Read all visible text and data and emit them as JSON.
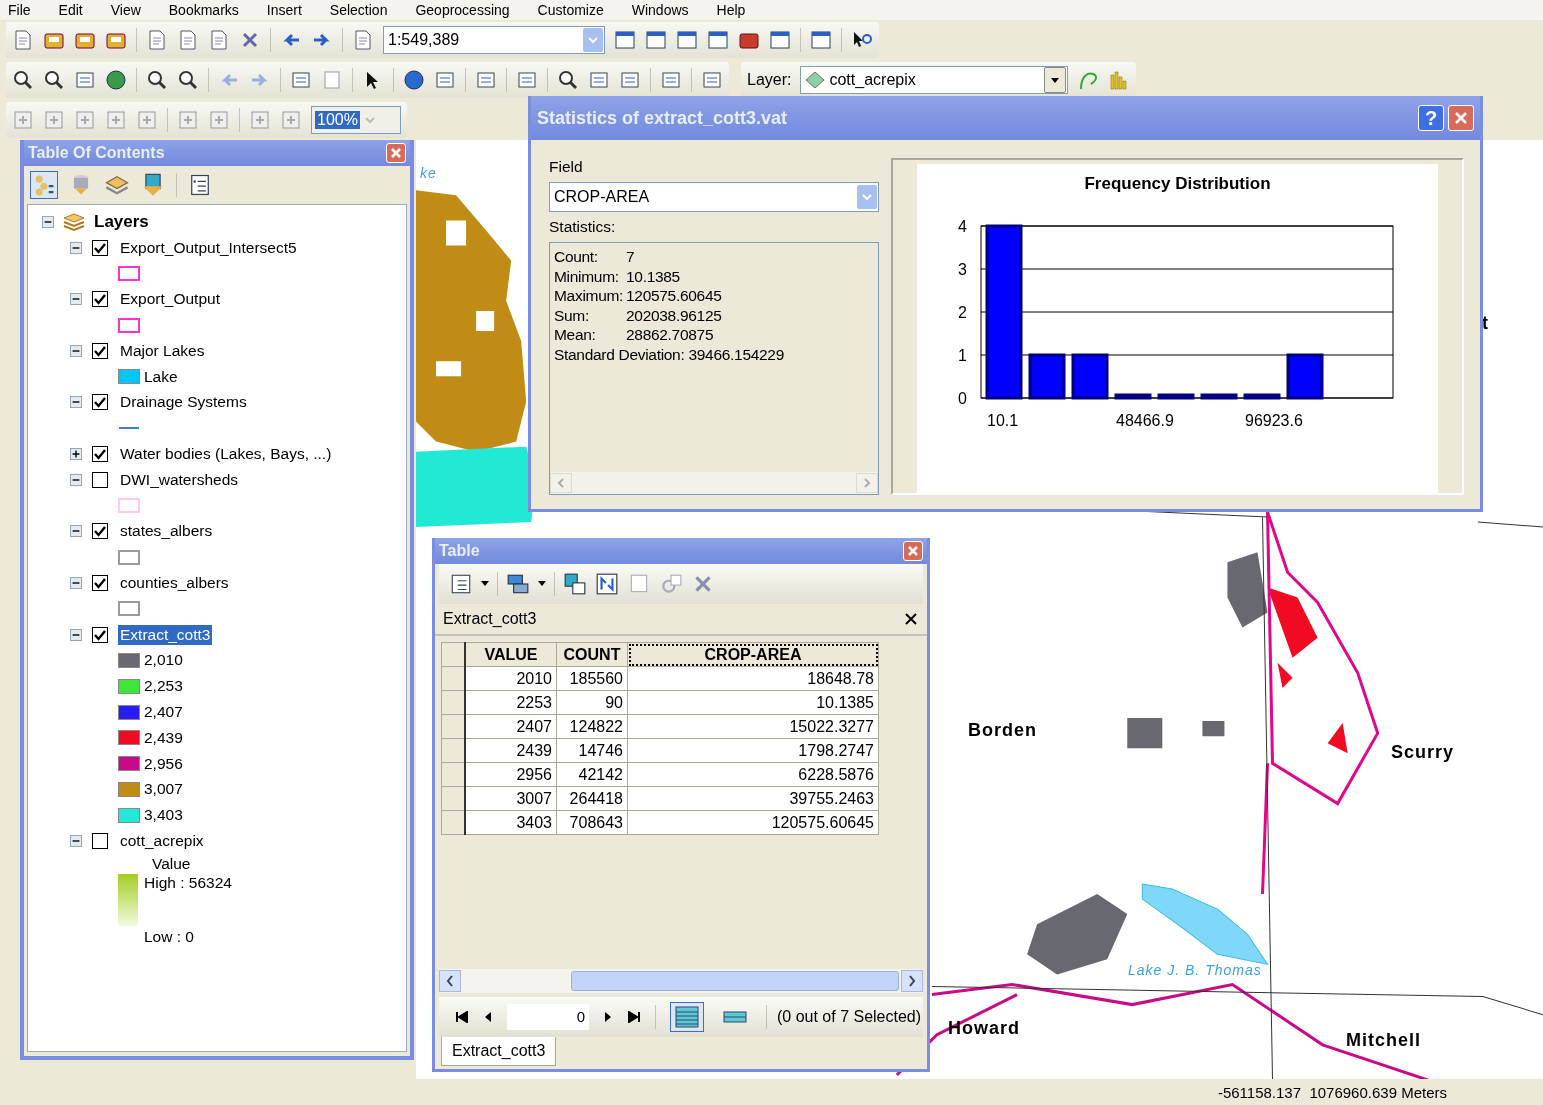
{
  "menu": [
    "File",
    "Edit",
    "View",
    "Bookmarks",
    "Insert",
    "Selection",
    "Geoprocessing",
    "Customize",
    "Windows",
    "Help"
  ],
  "toolbar": {
    "scale": "1:549,389",
    "layer_label": "Layer:",
    "layer": "cott_acrepix",
    "zoom": "100%"
  },
  "toc": {
    "title": "Table Of Contents",
    "root": {
      "label": "Layers",
      "expanded": true,
      "children": [
        {
          "label": "Export_Output_Intersect5",
          "checked": true,
          "expanded": true,
          "selected": false,
          "legend": [
            {
              "kind": "outline",
              "color": "#ff33cc"
            }
          ]
        },
        {
          "label": "Export_Output",
          "checked": true,
          "expanded": true,
          "selected": false,
          "legend": [
            {
              "kind": "outline",
              "color": "#ff33cc"
            }
          ]
        },
        {
          "label": "Major Lakes",
          "checked": true,
          "expanded": true,
          "selected": false,
          "legend": [
            {
              "kind": "swatch",
              "color": "#00c5ff",
              "label": "Lake"
            }
          ]
        },
        {
          "label": "Drainage Systems",
          "checked": true,
          "expanded": true,
          "selected": false,
          "legend": [
            {
              "kind": "line",
              "color": "#3a7ee8"
            }
          ]
        },
        {
          "label": "Water bodies (Lakes, Bays, ...)",
          "checked": true,
          "expanded": false,
          "selected": false
        },
        {
          "label": "DWI_watersheds",
          "checked": false,
          "expanded": true,
          "selected": false,
          "legend": [
            {
              "kind": "outline",
              "color": "#ffc8ec"
            }
          ]
        },
        {
          "label": "states_albers",
          "checked": true,
          "expanded": true,
          "selected": false,
          "legend": [
            {
              "kind": "outline",
              "color": "#9a9a9a"
            }
          ]
        },
        {
          "label": "counties_albers",
          "checked": true,
          "expanded": true,
          "selected": false,
          "legend": [
            {
              "kind": "outline",
              "color": "#9a9a9a"
            }
          ]
        },
        {
          "label": "Extract_cott3",
          "checked": true,
          "expanded": true,
          "selected": true,
          "legend": [
            {
              "kind": "swatch",
              "color": "#686870",
              "label": "2,010"
            },
            {
              "kind": "swatch",
              "color": "#3ee63a",
              "label": "2,253"
            },
            {
              "kind": "swatch",
              "color": "#2a1cf5",
              "label": "2,407"
            },
            {
              "kind": "swatch",
              "color": "#f00a22",
              "label": "2,439"
            },
            {
              "kind": "swatch",
              "color": "#c80a88",
              "label": "2,956"
            },
            {
              "kind": "swatch",
              "color": "#c08c16",
              "label": "3,007"
            },
            {
              "kind": "swatch",
              "color": "#22e8d6",
              "label": "3,403"
            }
          ]
        },
        {
          "label": "cott_acrepix",
          "checked": false,
          "expanded": true,
          "selected": false,
          "legend": [
            {
              "kind": "ramp",
              "title": "Value",
              "high": "High : 56324",
              "low": "Low : 0"
            }
          ]
        }
      ]
    }
  },
  "map_labels": [
    {
      "text": "ke",
      "kind": "water"
    },
    {
      "text": "t",
      "kind": "county"
    },
    {
      "text": "Borden",
      "kind": "county"
    },
    {
      "text": "Scurry",
      "kind": "county"
    },
    {
      "text": "Lake J. B. Thomas",
      "kind": "water"
    },
    {
      "text": "Howard",
      "kind": "county"
    },
    {
      "text": "Mitchell",
      "kind": "county"
    }
  ],
  "statistics": {
    "title": "Statistics of extract_cott3.vat",
    "help_button": "?",
    "field_label": "Field",
    "field": "CROP-AREA",
    "stats_label": "Statistics:",
    "stats": [
      {
        "label": "Count:",
        "value": "7",
        "kind": "aligned"
      },
      {
        "label": "Minimum:",
        "value": "10.1385",
        "kind": "aligned"
      },
      {
        "label": "Maximum:",
        "value": "120575.60645",
        "kind": "aligned"
      },
      {
        "label": "Sum:",
        "value": "202038.96125",
        "kind": "aligned"
      },
      {
        "label": "Mean:",
        "value": "28862.70875",
        "kind": "aligned"
      },
      {
        "label": "Standard Deviation:",
        "value": "39466.154229",
        "kind": "inline"
      }
    ],
    "chart_data": {
      "type": "bar",
      "title": "Frequency Distribution",
      "categories": [
        "10.1",
        null,
        null,
        "48466.9",
        null,
        null,
        "96923.6",
        null
      ],
      "values": [
        4,
        1,
        1,
        0,
        0,
        0,
        0,
        1
      ],
      "ylim": [
        0,
        4
      ],
      "yticks": [
        0,
        1,
        2,
        3,
        4
      ],
      "grid": true
    }
  },
  "table": {
    "title": "Table",
    "tab_title": "Extract_cott3",
    "columns": [
      {
        "label": "VALUE",
        "selected": false
      },
      {
        "label": "COUNT",
        "selected": false
      },
      {
        "label": "CROP-AREA",
        "selected": true
      }
    ],
    "rows": [
      [
        "2010",
        "185560",
        "18648.78"
      ],
      [
        "2253",
        "90",
        "10.1385"
      ],
      [
        "2407",
        "124822",
        "15022.3277"
      ],
      [
        "2439",
        "14746",
        "1798.2747"
      ],
      [
        "2956",
        "42142",
        "6228.5876"
      ],
      [
        "3007",
        "264418",
        "39755.2463"
      ],
      [
        "3403",
        "708643",
        "120575.60645"
      ]
    ],
    "record": "0",
    "views": [
      {
        "kind": "all",
        "selected": true
      },
      {
        "kind": "selected",
        "selected": false
      }
    ],
    "selection_status": "(0 out of 7 Selected)",
    "bottom_tab": "Extract_cott3"
  },
  "status_bar": {
    "coordinates": "-561158.137  1076960.639 Meters"
  }
}
